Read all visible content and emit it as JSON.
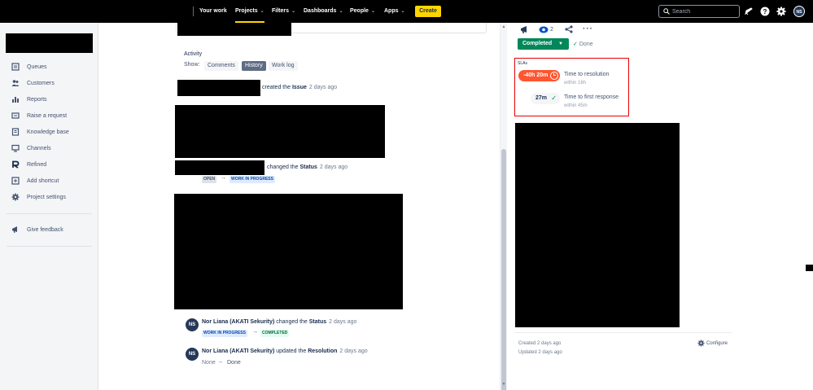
{
  "topnav": {
    "items": [
      {
        "label": "Your work",
        "has_caret": false
      },
      {
        "label": "Projects",
        "has_caret": true,
        "active": true
      },
      {
        "label": "Filters",
        "has_caret": true
      },
      {
        "label": "Dashboards",
        "has_caret": true
      },
      {
        "label": "People",
        "has_caret": true
      },
      {
        "label": "Apps",
        "has_caret": true
      }
    ],
    "create_label": "Create",
    "search_placeholder": "Search",
    "icons": [
      "notifications-icon",
      "help-icon",
      "settings-icon"
    ],
    "avatar_initials": "NS",
    "accent_color": "#ffd400"
  },
  "sidebar": {
    "items": [
      {
        "label": "Queues",
        "icon": "queues-icon"
      },
      {
        "label": "Customers",
        "icon": "customers-icon"
      },
      {
        "label": "Reports",
        "icon": "reports-icon"
      },
      {
        "label": "Raise a request",
        "icon": "raise-request-icon"
      },
      {
        "label": "Knowledge base",
        "icon": "knowledge-base-icon"
      },
      {
        "label": "Channels",
        "icon": "channels-icon"
      },
      {
        "label": "Refined",
        "icon": "refined-icon"
      },
      {
        "label": "Add shortcut",
        "icon": "add-shortcut-icon"
      },
      {
        "label": "Project settings",
        "icon": "project-settings-icon"
      }
    ],
    "feedback_label": "Give feedback"
  },
  "activity": {
    "heading": "Activity",
    "show_label": "Show:",
    "tabs": [
      {
        "label": "Comments",
        "selected": false
      },
      {
        "label": "History",
        "selected": true
      },
      {
        "label": "Work log",
        "selected": false
      }
    ],
    "entries": {
      "created": {
        "text": "created the ",
        "field": "Issue",
        "time": "2 days ago"
      },
      "status1": {
        "text": "changed the ",
        "field": "Status",
        "time": "2 days ago",
        "from": "OPEN",
        "to": "WORK IN PROGRESS"
      },
      "status2": {
        "author": "Nor Liana (AKATI Sekurity)",
        "text": " changed the ",
        "field": "Status",
        "time": "2 days ago",
        "from": "WORK IN PROGRESS",
        "to": "COMPLETED",
        "avatar": "NS"
      },
      "resolution": {
        "author": "Nor Liana (AKATI Sekurity)",
        "text": " updated the ",
        "field": "Resolution",
        "time": "2 days ago",
        "from": "None",
        "to": "Done",
        "avatar": "NS"
      }
    },
    "arrow": "→"
  },
  "right_panel": {
    "watch_count": "2",
    "status_label": "Completed",
    "status_color": "#00875a",
    "resolution_label": "Done",
    "sla": {
      "title": "SLAs",
      "items": [
        {
          "value": "-40h 20m",
          "name": "Time to resolution",
          "goal": "within 16h",
          "state": "breached",
          "color": "#ff5630"
        },
        {
          "value": "27m",
          "name": "Time to first response",
          "goal": "within 45m",
          "state": "met",
          "color": "#00875a"
        }
      ]
    },
    "created": "Created 2 days ago",
    "updated": "Updated 2 days ago",
    "configure_label": "Configure"
  }
}
